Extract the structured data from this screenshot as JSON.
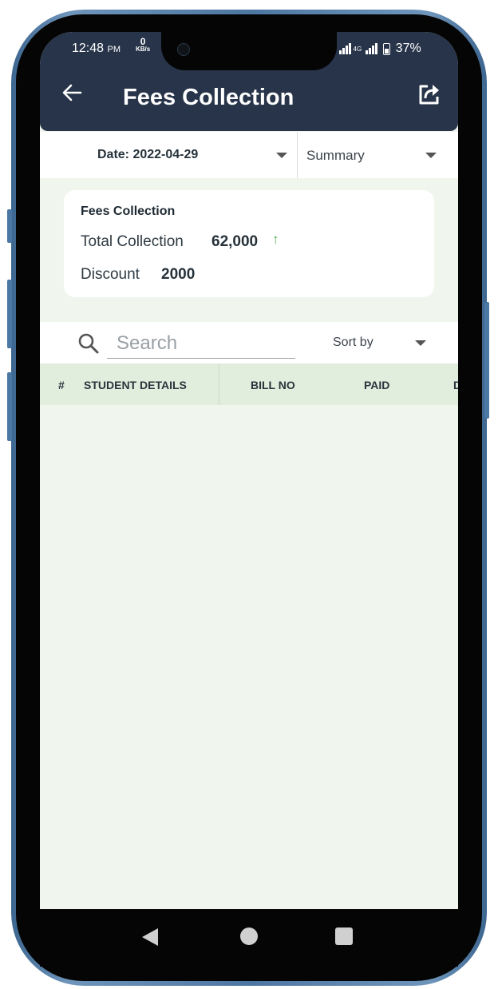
{
  "status_bar": {
    "time": "12:48",
    "time_suffix": "PM",
    "net_speed_value": "0",
    "net_speed_unit": "KB/s",
    "network_type": "4G",
    "battery": "37%"
  },
  "header": {
    "title": "Fees Collection",
    "back_icon": "arrow-left-icon",
    "share_icon": "share-export-icon"
  },
  "filters": {
    "date_label": "Date: 2022-04-29",
    "view_label": "Summary"
  },
  "summary_card": {
    "title": "Fees Collection",
    "total_collection_label": "Total Collection",
    "total_collection_value": "62,000",
    "trend_arrow": "↑",
    "discount_label": "Discount",
    "discount_value": "2000"
  },
  "search": {
    "placeholder": "Search",
    "value": "",
    "sort_label": "Sort by"
  },
  "table": {
    "columns": [
      "#",
      "STUDENT DETAILS",
      "BILL NO",
      "PAID",
      "D"
    ],
    "rows": []
  },
  "colors": {
    "app_bar": "#273449",
    "table_header": "#e1eedd",
    "background": "#f0f5ee",
    "trend_up": "#4caf50"
  },
  "nav_bar": {
    "back_icon": "triangle-back-icon",
    "home_icon": "circle-home-icon",
    "recents_icon": "square-recents-icon"
  }
}
